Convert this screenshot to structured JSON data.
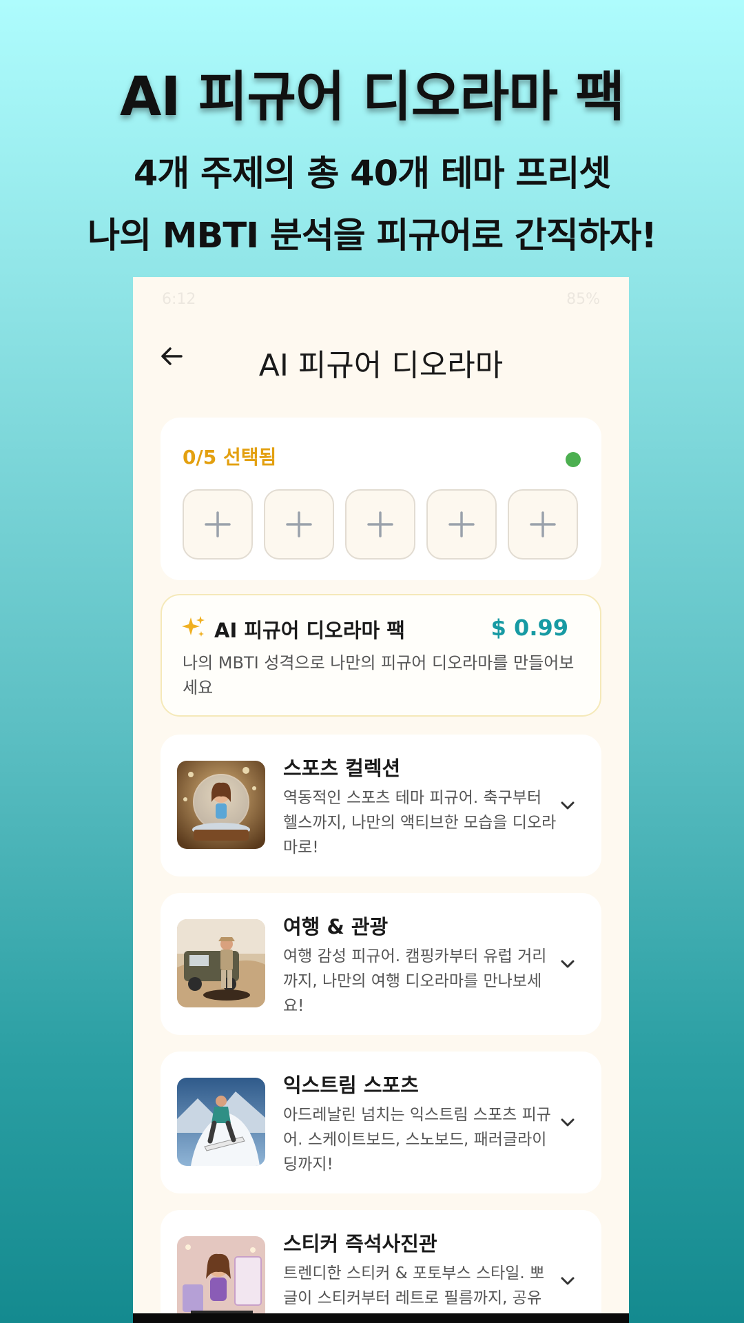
{
  "promo": {
    "title": "AI 피규어 디오라마 팩",
    "subtitle1": "4개 주제의 총 40개 테마 프리셋",
    "subtitle2": "나의 MBTI 분석을 피규어로 간직하자!"
  },
  "status_bar": {
    "time": "6:12",
    "battery": "85%"
  },
  "header": {
    "title": "AI 피규어 디오라마"
  },
  "selection": {
    "count_label": "0/5 선택됨",
    "slots": 5
  },
  "pack": {
    "title": "AI 피규어 디오라마 팩",
    "price": "$ 0.99",
    "description": "나의 MBTI 성격으로 나만의 피규어 디오라마를 만들어보세요"
  },
  "themes": [
    {
      "title": "스포츠 컬렉션",
      "description": "역동적인 스포츠 테마 피규어. 축구부터 헬스까지, 나만의 액티브한 모습을 디오라마로!"
    },
    {
      "title": "여행 & 관광",
      "description": "여행 감성 피규어. 캠핑카부터 유럽 거리까지, 나만의 여행 디오라마를 만나보세요!"
    },
    {
      "title": "익스트림 스포츠",
      "description": "아드레날린 넘치는 익스트림 스포츠 피규어. 스케이트보드, 스노보드, 패러글라이딩까지!"
    },
    {
      "title": "스티커 즉석사진관",
      "description": "트렌디한 스티커 & 포토부스 스타일. 뽀글이 스티커부터 레트로 필름까지, 공유"
    }
  ],
  "colors": {
    "accent_orange": "#e3a010",
    "price_teal": "#179aa3",
    "status_green": "#4caf50"
  }
}
